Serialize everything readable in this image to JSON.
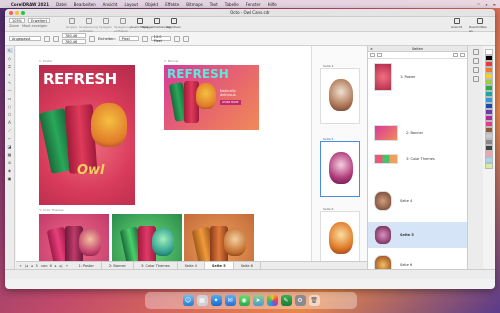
{
  "menubar": {
    "app_name": "CorelDRAW 2021",
    "items": [
      "Datei",
      "Bearbeiten",
      "Ansicht",
      "Layout",
      "Objekt",
      "Effekte",
      "Bitmaps",
      "Text",
      "Tabelle",
      "Fenster",
      "Hilfe"
    ]
  },
  "window": {
    "title": "Octo - Owl Cans.cdr"
  },
  "toolbar": {
    "zoom_value": "105%",
    "zoom_label": "Zoom",
    "mode_value": "Erweitert",
    "mode_label": "Modi anzeigen",
    "tools": [
      "Gruppe",
      "Gruppierung aufheben",
      "Spiegeln",
      "Spiegelung aufheben",
      "Ausrichtung",
      "Spiegelmarkierung",
      "Anordnen"
    ],
    "right_tools": [
      "Ansicht",
      "Zuschnitten an"
    ]
  },
  "propbar": {
    "preset": "Angepasst",
    "width": "780.46",
    "height": "780.46",
    "units_label": "Einheiten:",
    "units_value": "Pixel",
    "nudge": "10.0 Pixel"
  },
  "canvas": {
    "page_labels": [
      "1: Poster",
      "2: Banner",
      "3: Color Themes"
    ],
    "poster_title": "REFRESH",
    "banner_title": "REFRESH",
    "banner_tagline": "Naturally delicious.",
    "banner_button": "LEARN MORE"
  },
  "pagestrip": {
    "labels": [
      "Seite 4",
      "Seite 5",
      "Seite 6"
    ]
  },
  "docker": {
    "title": "Seiten",
    "rows": [
      {
        "label": "1: Poster"
      },
      {
        "label": "2: Banner"
      },
      {
        "label": "3: Color Themes"
      },
      {
        "label": "Seite 4"
      },
      {
        "label": "Seite 5"
      },
      {
        "label": "Seite 6"
      }
    ]
  },
  "tabs": {
    "page_counter": "5",
    "page_total": "von: 6",
    "items": [
      "1: Poster",
      "2: Banner",
      "3: Color Themes",
      "Seite 4",
      "Seite 5",
      "Seite 6"
    ]
  },
  "palette_colors": [
    "#ffffff",
    "#000000",
    "#e83a3a",
    "#f07a2a",
    "#f5d020",
    "#9ad040",
    "#2aa84a",
    "#1aa8a0",
    "#2a9ad8",
    "#1a4ab0",
    "#6a3ab0",
    "#b02a9a",
    "#e83a8a",
    "#8a5a3a",
    "#c8c8c8",
    "#888888",
    "#444444",
    "#f5a0b0",
    "#a0d8f0",
    "#d0f0a0"
  ],
  "dock_apps": [
    "Finder",
    "Launchpad",
    "Safari",
    "Mail",
    "Nachrichten",
    "Karten",
    "Fotos",
    "CorelDRAW",
    "Systemeinstellungen",
    "Papierkorb"
  ]
}
